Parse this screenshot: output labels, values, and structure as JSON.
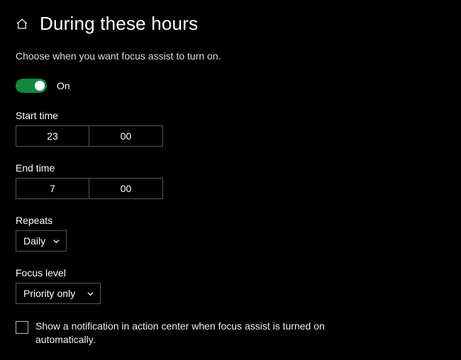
{
  "header": {
    "title": "During these hours"
  },
  "subtitle": "Choose when you want focus assist to turn on.",
  "toggle": {
    "state": "On"
  },
  "start": {
    "label": "Start time",
    "hour": "23",
    "minute": "00"
  },
  "end": {
    "label": "End time",
    "hour": "7",
    "minute": "00"
  },
  "repeats": {
    "label": "Repeats",
    "value": "Daily"
  },
  "focus_level": {
    "label": "Focus level",
    "value": "Priority only"
  },
  "notify_checkbox": {
    "label": "Show a notification in action center when focus assist is turned on automatically.",
    "checked": false
  },
  "colors": {
    "accent_toggle": "#10893e"
  }
}
